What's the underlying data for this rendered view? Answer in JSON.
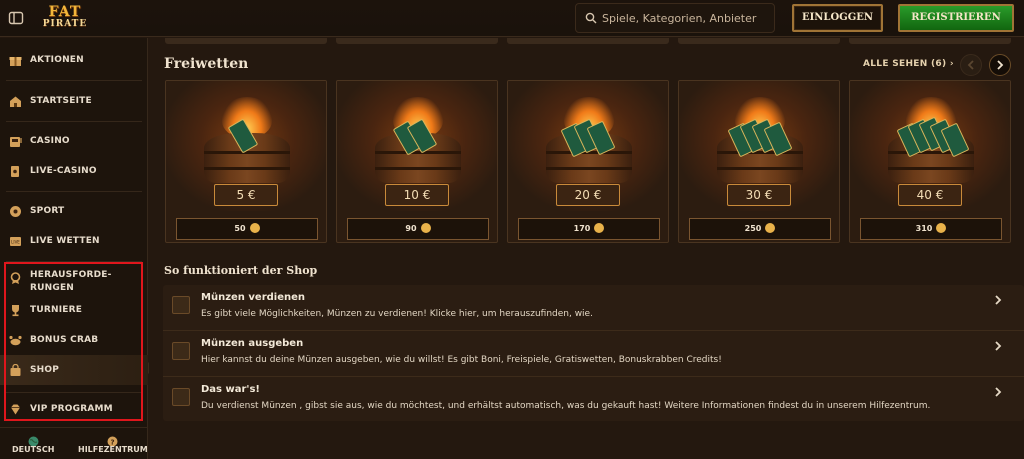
{
  "header": {
    "logo_top": "FAT",
    "logo_bottom": "PIRATE",
    "search_placeholder": "Spiele, Kategorien, Anbieter",
    "login_label": "EINLOGGEN",
    "register_label": "REGISTRIEREN"
  },
  "sidebar": {
    "items": [
      {
        "label": "AKTIONEN",
        "icon": "gift-icon"
      },
      {
        "label": "STARTSEITE",
        "icon": "home-icon"
      },
      {
        "label": "CASINO",
        "icon": "slot-machine-icon"
      },
      {
        "label": "LIVE-CASINO",
        "icon": "cards-icon"
      },
      {
        "label": "SPORT",
        "icon": "ball-icon"
      },
      {
        "label": "LIVE WETTEN",
        "icon": "live-icon"
      },
      {
        "label": "HERAUSFORDE-RUNGEN",
        "icon": "medal-icon"
      },
      {
        "label": "TURNIERE",
        "icon": "trophy-icon"
      },
      {
        "label": "BONUS CRAB",
        "icon": "crab-icon"
      },
      {
        "label": "SHOP",
        "icon": "shop-bag-icon",
        "active": true
      },
      {
        "label": "VIP PROGRAMM",
        "icon": "diamond-icon"
      }
    ],
    "footer": {
      "language_label": "DEUTSCH",
      "help_label": "HILFEZENTRUM"
    }
  },
  "freebets": {
    "title": "Freiwetten",
    "see_all": "ALLE SEHEN (6)",
    "cards": [
      {
        "price": "5 €",
        "cost": "50"
      },
      {
        "price": "10 €",
        "cost": "90"
      },
      {
        "price": "20 €",
        "cost": "170"
      },
      {
        "price": "30 €",
        "cost": "250"
      },
      {
        "price": "40 €",
        "cost": "310"
      }
    ]
  },
  "how": {
    "title": "So funktioniert der Shop",
    "rows": [
      {
        "title": "Münzen verdienen",
        "desc": "Es gibt viele Möglichkeiten, Münzen zu verdienen! Klicke hier, um herauszufinden, wie."
      },
      {
        "title": "Münzen ausgeben",
        "desc": "Hier kannst du deine Münzen ausgeben, wie du willst! Es gibt Boni, Freispiele, Gratiswetten, Bonuskrabben Credits!"
      },
      {
        "title": "Das war's!",
        "desc": "Du verdienst Münzen , gibst sie aus, wie du möchtest, und erhältst automatisch, was du gekauft hast! Weitere Informationen findest du in unserem Hilfezentrum."
      }
    ]
  },
  "colors": {
    "accent_gold": "#c98a3a",
    "register_green": "#1f8a1f",
    "highlight_red": "#e0161c"
  }
}
